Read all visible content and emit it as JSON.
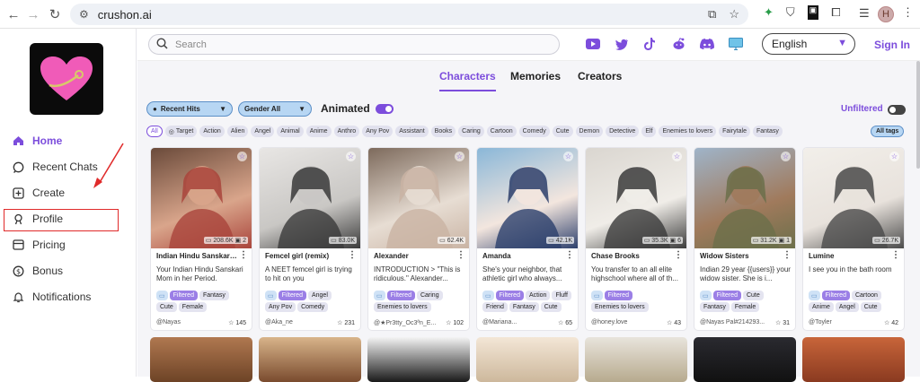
{
  "browser": {
    "url": "crushon.ai",
    "profile_initial": "H"
  },
  "sidebar": {
    "items": [
      {
        "label": "Home",
        "icon": "home-icon"
      },
      {
        "label": "Recent Chats",
        "icon": "chat-icon"
      },
      {
        "label": "Create",
        "icon": "plus-square-icon"
      },
      {
        "label": "Profile",
        "icon": "profile-icon"
      },
      {
        "label": "Pricing",
        "icon": "pricing-icon"
      },
      {
        "label": "Bonus",
        "icon": "dollar-icon"
      },
      {
        "label": "Notifications",
        "icon": "bell-icon"
      }
    ],
    "accent_color": "#7c4ddc",
    "highlight_color": "#e02a2a"
  },
  "header": {
    "search_placeholder": "Search",
    "language": "English",
    "signin": "Sign In"
  },
  "tabs": [
    "Characters",
    "Memories",
    "Creators"
  ],
  "filters": {
    "sort": "Recent Hits",
    "gender": "Gender All",
    "animated_label": "Animated",
    "unfiltered_label": "Unfiltered"
  },
  "tags": [
    "All",
    "Target",
    "Action",
    "Alien",
    "Angel",
    "Animal",
    "Anime",
    "Anthro",
    "Any Pov",
    "Assistant",
    "Books",
    "Caring",
    "Cartoon",
    "Comedy",
    "Cute",
    "Demon",
    "Detective",
    "Elf",
    "Enemies to lovers",
    "Fairytale",
    "Fantasy"
  ],
  "all_tags_label": "All tags",
  "cards": [
    {
      "name": "Indian Hindu Sanskari ...",
      "stat": "208.6K",
      "stat2": "2",
      "desc": "Your Indian Hindu Sanskari Mom in her Period.",
      "tags": [
        "Filtered",
        "Fantasy",
        "Cute",
        "Female"
      ],
      "author": "@Nayas",
      "likes": "145"
    },
    {
      "name": "Femcel girl (remix)",
      "stat": "83.0K",
      "stat2": "",
      "desc": "A NEET femcel girl is trying to hit on you",
      "tags": [
        "Filtered",
        "Angel",
        "Any Pov",
        "Comedy"
      ],
      "author": "@Aka_ne",
      "likes": "231"
    },
    {
      "name": "Alexander",
      "stat": "62.4K",
      "stat2": "",
      "desc": "INTRODUCTION > \"This is ridiculous.\" Alexander...",
      "tags": [
        "Filtered",
        "Caring",
        "Enemies to lovers"
      ],
      "author": "@★Pr3tty_Oc3ªn_E...",
      "likes": "102"
    },
    {
      "name": "Amanda",
      "stat": "42.1K",
      "stat2": "",
      "desc": "She's your neighbor, that athletic girl who always...",
      "tags": [
        "Filtered",
        "Action",
        "Fluff",
        "Friend",
        "Fantasy",
        "Cute"
      ],
      "author": "@Mariana...",
      "likes": "65"
    },
    {
      "name": "Chase Brooks",
      "stat": "35.3K",
      "stat2": "6",
      "desc": "You transfer to an all elite highschool where all of th...",
      "tags": [
        "Filtered",
        "Enemies to lovers"
      ],
      "author": "@honey.love",
      "likes": "43"
    },
    {
      "name": "Widow Sisters",
      "stat": "31.2K",
      "stat2": "1",
      "desc": "Indian 29 year {{users}} your widow sister. She is i...",
      "tags": [
        "Filtered",
        "Cute",
        "Fantasy",
        "Female"
      ],
      "author": "@Nayas Pal#214293...",
      "likes": "31"
    },
    {
      "name": "Lumine",
      "stat": "26.7K",
      "stat2": "",
      "desc": "I see you in the bath room",
      "tags": [
        "Filtered",
        "Cartoon",
        "Anime",
        "Angel",
        "Cute"
      ],
      "author": "@Toyler",
      "likes": "42"
    }
  ]
}
